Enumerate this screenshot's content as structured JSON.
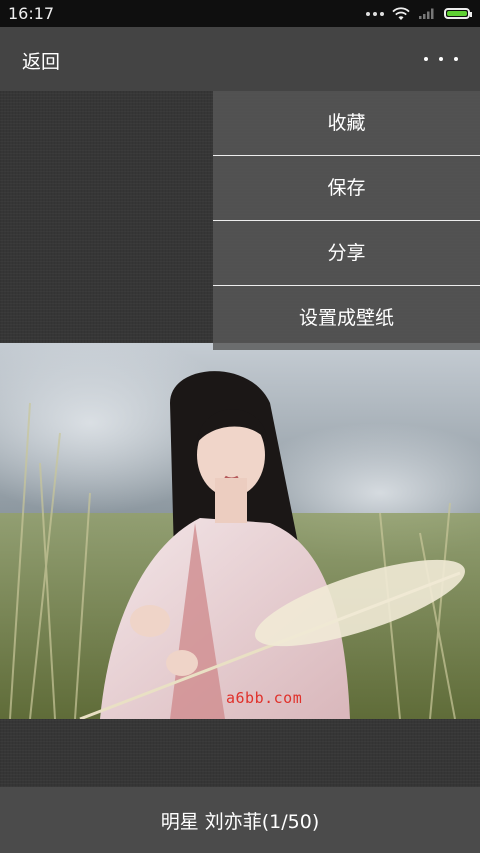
{
  "status_bar": {
    "time": "16:17",
    "battery_color": "#5fd034"
  },
  "app_bar": {
    "back_label": "返回",
    "more_icon": "more-dots-icon"
  },
  "menu": {
    "items": [
      {
        "label": "收藏"
      },
      {
        "label": "保存"
      },
      {
        "label": "分享"
      },
      {
        "label": "设置成壁纸"
      }
    ]
  },
  "photo": {
    "watermark": "a6bb.com"
  },
  "footer": {
    "caption": "明星 刘亦菲(1/50)"
  }
}
